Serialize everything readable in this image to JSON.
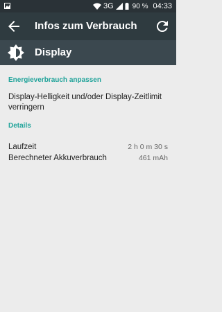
{
  "statusbar": {
    "network": "3G",
    "battery_percent": "90 %",
    "time": "04:33"
  },
  "appbar": {
    "title": "Infos zum Verbrauch"
  },
  "header": {
    "label": "Display"
  },
  "sections": {
    "adjust": {
      "title": "Energieverbrauch anpassen",
      "item": "Display-Helligkeit und/oder Display-Zeitlimit verringern"
    },
    "details": {
      "title": "Details",
      "rows": [
        {
          "label": "Laufzeit",
          "value": "2 h 0 m 30 s"
        },
        {
          "label": "Berechneter Akkuverbrauch",
          "value": "461 mAh"
        }
      ]
    }
  },
  "colors": {
    "statusbar_bg": "#2a3237",
    "appbar_bg": "#2f3b40",
    "header_bg": "#3b484f",
    "accent": "#20a39a",
    "page_bg": "#ececec"
  },
  "icons": {
    "statusbar_left": "image-icon",
    "back": "arrow-left-icon",
    "refresh": "refresh-icon",
    "display": "brightness-icon"
  }
}
